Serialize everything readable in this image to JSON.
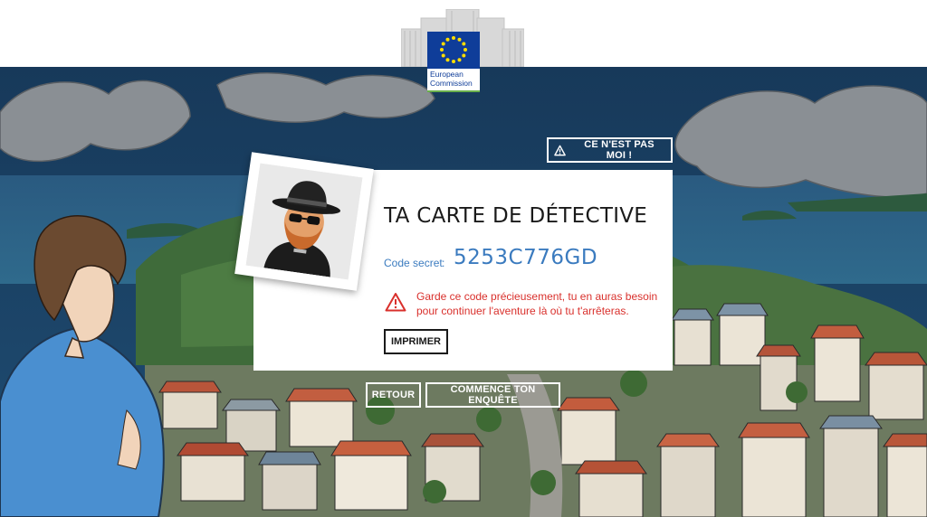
{
  "logo": {
    "line1": "European",
    "line2": "Commission"
  },
  "buttons": {
    "not_me": "CE N'EST PAS MOI !",
    "back": "RETOUR",
    "start": "COMMENCE TON ENQUÊTE",
    "print": "IMPRIMER"
  },
  "card": {
    "title": "TA CARTE DE DÉTECTIVE",
    "code_label": "Code secret",
    "code_colon": ":",
    "code_value": "5253C776GD",
    "warning_line1": "Garde ce code précieusement, tu en auras besoin",
    "warning_line2": "pour continuer l'aventure là où tu t'arrêteras."
  },
  "icons": {
    "not_me": "warning-icon",
    "card_warning": "warning-icon",
    "avatar": "detective-avatar"
  },
  "colors": {
    "accent_blue": "#3b7bbf",
    "warning_red": "#d9302c",
    "eu_blue": "#0f3d99",
    "eu_yellow": "#ffdd00",
    "sea": "#1e4a6e"
  }
}
